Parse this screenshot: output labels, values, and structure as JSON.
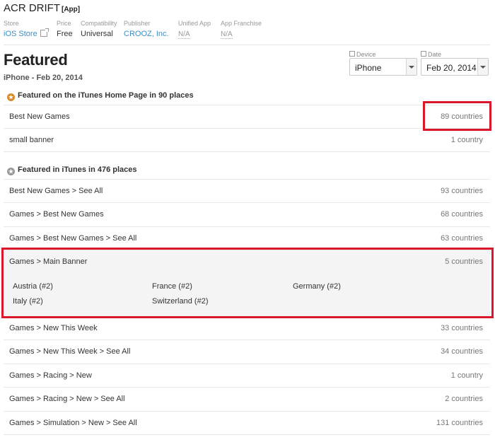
{
  "app": {
    "name": "ACR DRIFT",
    "tag": "[App]"
  },
  "meta": [
    {
      "label": "Store",
      "value": "iOS Store"
    },
    {
      "label": "Price",
      "value": "Free"
    },
    {
      "label": "Compatibility",
      "value": "Universal"
    },
    {
      "label": "Publisher",
      "value": "CROOZ, Inc."
    },
    {
      "label": "Unified App",
      "value": "N/A"
    },
    {
      "label": "App Franchise",
      "value": "N/A"
    }
  ],
  "featured": {
    "title": "Featured",
    "subtitle": "iPhone - Feb 20, 2014"
  },
  "filters": {
    "device": {
      "label": "Device",
      "value": "iPhone"
    },
    "date": {
      "label": "Date",
      "value": "Feb 20, 2014"
    }
  },
  "sections": {
    "home": {
      "prefix": "Featured on the iTunes Home Page in ",
      "count": "90 places",
      "rows": [
        {
          "name": "Best New Games",
          "count": "89 countries"
        },
        {
          "name": "small banner",
          "count": "1 country"
        }
      ]
    },
    "itunes": {
      "prefix": "Featured in iTunes in ",
      "count": "476 places",
      "rows": [
        {
          "name": "Best New Games > See All",
          "count": "93 countries"
        },
        {
          "name": "Games > Best New Games",
          "count": "68 countries"
        },
        {
          "name": "Games > Best New Games > See All",
          "count": "63 countries"
        },
        {
          "name": "Games > Main Banner",
          "count": "5 countries",
          "countries": [
            "Austria (#2)",
            "France (#2)",
            "Germany (#2)",
            "Italy (#2)",
            "Switzerland (#2)"
          ]
        },
        {
          "name": "Games > New This Week",
          "count": "33 countries"
        },
        {
          "name": "Games > New This Week > See All",
          "count": "34 countries"
        },
        {
          "name": "Games > Racing > New",
          "count": "1 country"
        },
        {
          "name": "Games > Racing > New > See All",
          "count": "2 countries"
        },
        {
          "name": "Games > Simulation > New > See All",
          "count": "131 countries"
        }
      ]
    }
  },
  "colors": {
    "link": "#3b8ec2",
    "highlight": "#d9162a",
    "home_badge": "#d88a25"
  }
}
